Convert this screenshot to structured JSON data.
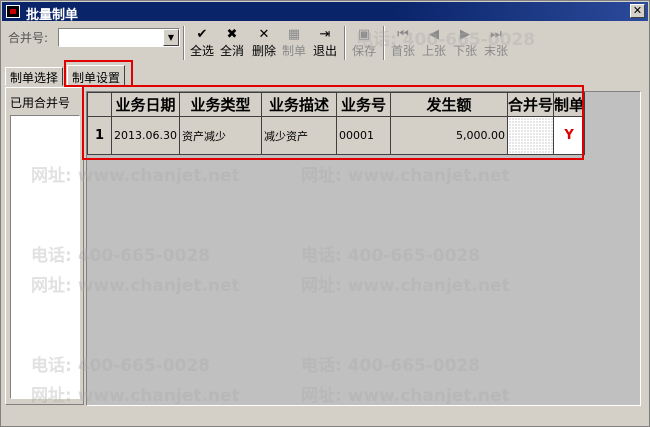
{
  "window": {
    "title": "批量制单"
  },
  "toolbar": {
    "merge_label": "合并号:",
    "merge_value": "",
    "buttons": [
      {
        "icon": "select-all-icon",
        "glyph": "✔",
        "label": "全选"
      },
      {
        "icon": "deselect-all-icon",
        "glyph": "✖",
        "label": "全消"
      },
      {
        "icon": "delete-icon",
        "glyph": "✕",
        "label": "删除"
      },
      {
        "icon": "voucher-icon",
        "glyph": "▦",
        "label": "制单"
      },
      {
        "icon": "exit-icon",
        "glyph": "⇥",
        "label": "退出"
      },
      {
        "icon": "save-icon",
        "glyph": "▣",
        "label": "保存"
      },
      {
        "icon": "first-icon",
        "glyph": "⏮",
        "label": "首张"
      },
      {
        "icon": "prev-icon",
        "glyph": "◀",
        "label": "上张"
      },
      {
        "icon": "next-icon",
        "glyph": "▶",
        "label": "下张"
      },
      {
        "icon": "last-icon",
        "glyph": "⏭",
        "label": "末张"
      }
    ]
  },
  "tabs": [
    {
      "label": "制单选择"
    },
    {
      "label": "制单设置"
    }
  ],
  "left_panel": {
    "label": "已用合并号"
  },
  "grid": {
    "columns": [
      "业务日期",
      "业务类型",
      "业务描述",
      "业务号",
      "发生额",
      "合并号",
      "制单"
    ],
    "rows": [
      {
        "num": "1",
        "date": "2013.06.30",
        "type": "资产减少",
        "desc": "减少资产",
        "no": "00001",
        "amount": "5,000.00",
        "merge": "",
        "flag": "Y"
      }
    ]
  },
  "watermark": {
    "phone": "电话: 400-665-0028",
    "site": "网址: www.chanjet.net"
  },
  "colors": {
    "title_bar": "#0a246a",
    "highlight": "#e00000",
    "flag": "#d00000"
  }
}
